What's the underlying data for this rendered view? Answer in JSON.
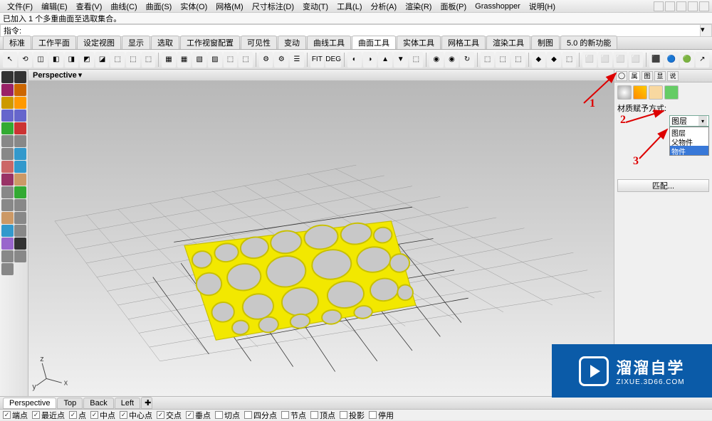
{
  "menubar": [
    "文件(F)",
    "编辑(E)",
    "查看(V)",
    "曲线(C)",
    "曲面(S)",
    "实体(O)",
    "网格(M)",
    "尺寸标注(D)",
    "变动(T)",
    "工具(L)",
    "分析(A)",
    "渲染(R)",
    "面板(P)",
    "Grasshopper",
    "说明(H)"
  ],
  "status_line": "已加入 1 个多重曲面至选取集合。",
  "cmd_label": "指令:",
  "cmd_value": "",
  "tabbar": [
    "标准",
    "工作平面",
    "设定视图",
    "显示",
    "选取",
    "工作视窗配置",
    "可见性",
    "变动",
    "曲线工具",
    "曲面工具",
    "实体工具",
    "网格工具",
    "渲染工具",
    "制图",
    "5.0 的新功能"
  ],
  "tabbar_active": 9,
  "viewport_title": "Perspective",
  "right_panel": {
    "tabs": [
      "◯",
      "属",
      "图",
      "显",
      "说"
    ],
    "active_tab": 1,
    "assign_label": "材质赋予方式:",
    "select_value": "图层",
    "dropdown_items": [
      "图层",
      "父物件",
      "物件"
    ],
    "dropdown_hl": 2,
    "match_btn": "匹配..."
  },
  "annotations": {
    "a1": "1",
    "a2": "2",
    "a3": "3"
  },
  "bottom_tabs": [
    "Perspective",
    "Top",
    "Back",
    "Left"
  ],
  "bottom_active": 0,
  "snaps": [
    {
      "label": "端点",
      "on": true
    },
    {
      "label": "最近点",
      "on": true
    },
    {
      "label": "点",
      "on": true
    },
    {
      "label": "中点",
      "on": true
    },
    {
      "label": "中心点",
      "on": true
    },
    {
      "label": "交点",
      "on": true
    },
    {
      "label": "垂点",
      "on": true
    },
    {
      "label": "切点",
      "on": false
    },
    {
      "label": "四分点",
      "on": false
    },
    {
      "label": "节点",
      "on": false
    },
    {
      "label": "顶点",
      "on": false
    },
    {
      "label": "投影",
      "on": false
    },
    {
      "label": "停用",
      "on": false
    }
  ],
  "logo": {
    "cn": "溜溜自学",
    "url": "ZIXUE.3D66.COM"
  },
  "axis": {
    "x": "x",
    "y": "y",
    "z": "z"
  }
}
